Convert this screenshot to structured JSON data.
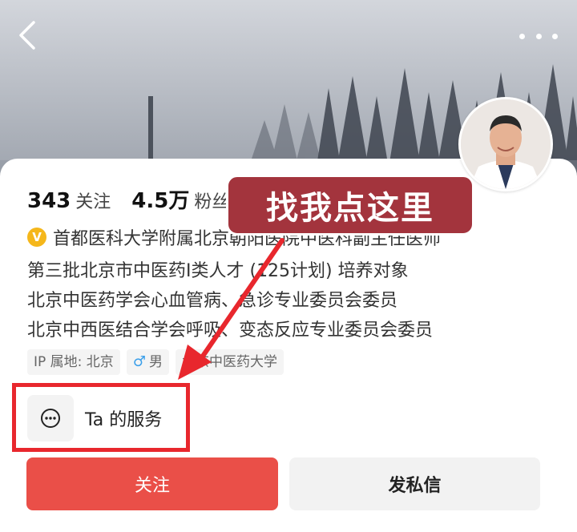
{
  "header": {
    "back_icon": "chevron-left-icon",
    "more_icon": "more-dots-icon"
  },
  "stats": {
    "following_count": "343",
    "following_label": "关注",
    "fans_count": "4.5万",
    "fans_label": "粉丝"
  },
  "profile": {
    "verify_badge": "V",
    "verify_text": "首都医科大学附属北京朝阳医院中医科副主任医师",
    "bio_lines": [
      "第三批北京市中医药I类人才 (125计划) 培养对象",
      "北京中医药学会心血管病、急诊专业委员会委员",
      "北京中西医结合学会呼吸、变态反应专业委员会委员"
    ]
  },
  "tags": {
    "ip": "IP 属地: 北京",
    "gender": "男",
    "school": "北京中医药大学"
  },
  "service": {
    "label": "Ta 的服务",
    "icon": "more-circle-icon"
  },
  "actions": {
    "follow_label": "关注",
    "message_label": "发私信"
  },
  "annotation": {
    "callout_text": "找我点这里"
  },
  "colors": {
    "accent_red": "#ea4f48",
    "callout_bg": "#a3343d",
    "highlight_border": "#e8272d",
    "verify_gold": "#f5b71b",
    "gender_blue": "#3b9fea"
  }
}
